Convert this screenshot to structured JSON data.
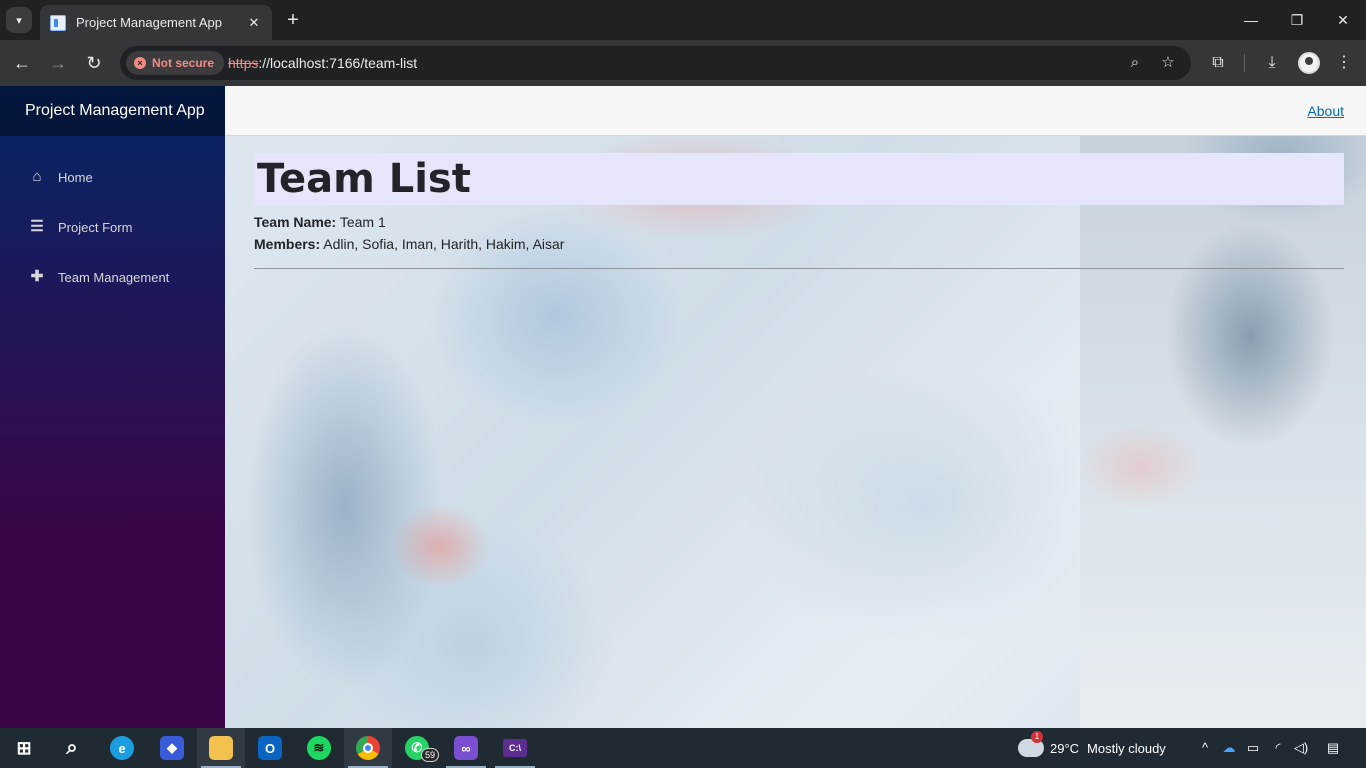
{
  "browser": {
    "tab_title": "Project Management App",
    "not_secure_label": "Not secure",
    "url_scheme": "https",
    "url_rest": "://localhost:7166/team-list",
    "icons": [
      "tab-search-icon",
      "close-icon",
      "new-tab-icon",
      "minimize-icon",
      "restore-icon",
      "window-close-icon",
      "back-icon",
      "forward-icon",
      "reload-icon",
      "zoom-icon",
      "bookmark-star-icon",
      "extensions-icon",
      "download-icon",
      "profile-avatar",
      "menu-kebab-icon"
    ]
  },
  "app": {
    "brand": "Project Management App",
    "about_link": "About",
    "nav": [
      {
        "label": "Home",
        "icon": "home-icon"
      },
      {
        "label": "Project Form",
        "icon": "list-icon"
      },
      {
        "label": "Team Management",
        "icon": "plus-icon"
      }
    ]
  },
  "page": {
    "heading": "Team List",
    "team_name_label": "Team Name:",
    "team_name_value": "Team 1",
    "members_label": "Members:",
    "members_value": "Adlin, Sofia, Iman, Harith, Hakim, Aisar"
  },
  "taskbar": {
    "apps": [
      "windows-start",
      "search",
      "edge",
      "copilot",
      "file-explorer",
      "outlook",
      "spotify",
      "chrome",
      "whatsapp",
      "visual-studio",
      "terminal"
    ],
    "whatsapp_badge": "59",
    "weather_badge": "1",
    "weather_temp": "29°C",
    "weather_desc": "Mostly cloudy"
  }
}
